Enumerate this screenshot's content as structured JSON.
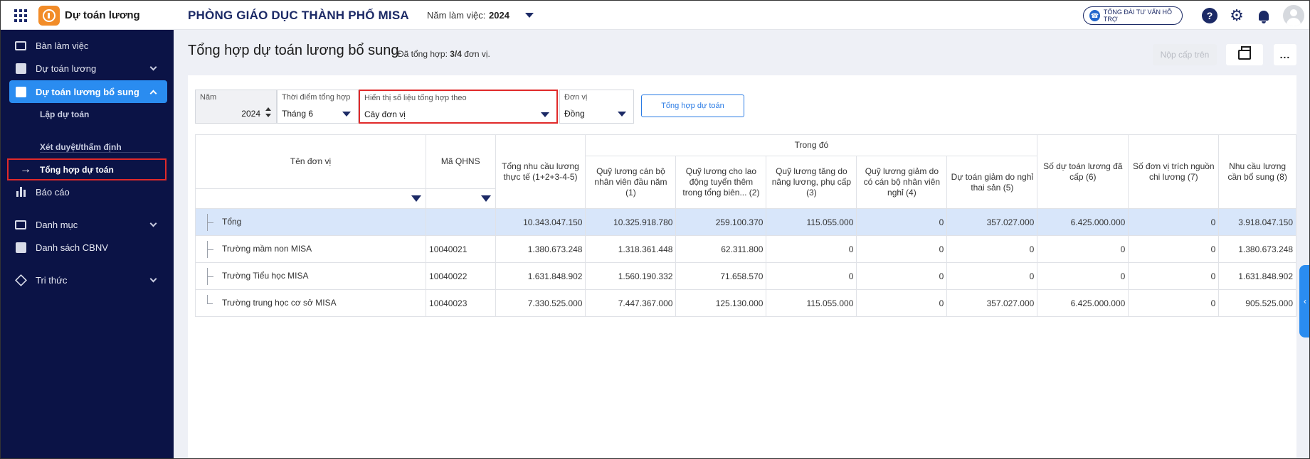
{
  "topbar": {
    "app_name": "Dự toán lương",
    "org_name": "PHÒNG GIÁO DỤC THÀNH PHỐ MISA",
    "year_label": "Năm làm việc:",
    "year_value": "2024",
    "hotline": "TỔNG ĐÀI TƯ VẤN HỖ TRỢ"
  },
  "sidebar": {
    "items": [
      {
        "label": "Bàn làm việc"
      },
      {
        "label": "Dự toán lương"
      },
      {
        "label": "Dự toán lương bổ sung"
      },
      {
        "label": "Báo cáo"
      },
      {
        "label": "Danh mục"
      },
      {
        "label": "Danh sách CBNV"
      },
      {
        "label": "Tri thức"
      }
    ],
    "sub_items": [
      {
        "label": "Lập dự toán"
      },
      {
        "label": "Xét duyệt/thẩm định"
      },
      {
        "label": "Tổng hợp dự toán"
      }
    ]
  },
  "page": {
    "title": "Tổng hợp dự toán lương bổ sung",
    "sub_prefix": "Đã tổng hợp:",
    "sub_count": "3/4",
    "sub_suffix": "đơn vị.",
    "submit_label": "Nộp cấp trên",
    "more_label": "..."
  },
  "filters": {
    "year": {
      "label": "Năm",
      "value": "2024"
    },
    "time": {
      "label": "Thời điểm tổng hợp",
      "value": "Tháng 6"
    },
    "view": {
      "label": "Hiển thị số liệu tổng hợp theo",
      "value": "Cây đơn vị"
    },
    "unit": {
      "label": "Đơn vị",
      "value": "Đồng"
    },
    "sum_button": "Tổng hợp dự toán"
  },
  "table": {
    "headers": {
      "name": "Tên đơn vị",
      "code": "Mã QHNS",
      "total_need": "Tổng nhu cầu lương thực tế (1+2+3-4-5)",
      "group": "Trong đó",
      "c1": "Quỹ lương cán bộ nhân viên đầu năm (1)",
      "c2": "Quỹ lương cho lao động tuyển thêm trong tổng biên... (2)",
      "c3": "Quỹ lương tăng do nâng lương, phụ cấp (3)",
      "c4": "Quỹ lương giảm do có cán bộ nhân viên nghỉ (4)",
      "c5": "Dự toán giảm do nghỉ thai sản (5)",
      "c6": "Số dự toán lương đã cấp (6)",
      "c7": "Số đơn vị trích nguồn chi lương (7)",
      "c8": "Nhu cầu lương cần bổ sung (8)"
    },
    "rows": [
      {
        "name": "Tổng",
        "code": "",
        "total": "10.343.047.150",
        "c1": "10.325.918.780",
        "c2": "259.100.370",
        "c3": "115.055.000",
        "c4": "0",
        "c5": "357.027.000",
        "c6": "6.425.000.000",
        "c7": "0",
        "c8": "3.918.047.150"
      },
      {
        "name": "Trường mầm non MISA",
        "code": "10040021",
        "total": "1.380.673.248",
        "c1": "1.318.361.448",
        "c2": "62.311.800",
        "c3": "0",
        "c4": "0",
        "c5": "0",
        "c6": "0",
        "c7": "0",
        "c8": "1.380.673.248"
      },
      {
        "name": "Trường Tiểu học MISA",
        "code": "10040022",
        "total": "1.631.848.902",
        "c1": "1.560.190.332",
        "c2": "71.658.570",
        "c3": "0",
        "c4": "0",
        "c5": "0",
        "c6": "0",
        "c7": "0",
        "c8": "1.631.848.902"
      },
      {
        "name": "Trường trung học cơ sở MISA",
        "code": "10040023",
        "total": "7.330.525.000",
        "c1": "7.447.367.000",
        "c2": "125.130.000",
        "c3": "115.055.000",
        "c4": "0",
        "c5": "357.027.000",
        "c6": "6.425.000.000",
        "c7": "0",
        "c8": "905.525.000"
      }
    ]
  },
  "colors": {
    "sidebar_bg": "#0b1346",
    "active": "#2a8cf0",
    "highlight": "#e02a2a",
    "total_row": "#d8e6fa"
  }
}
